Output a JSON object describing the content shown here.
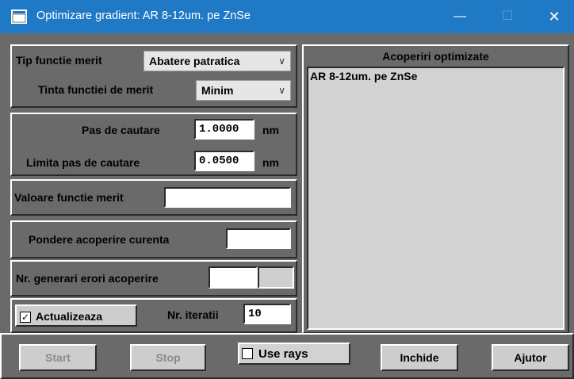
{
  "window": {
    "title": "Optimizare gradient: AR 8-12um. pe ZnSe",
    "minimize_glyph": "—",
    "maximize_glyph": "☐",
    "close_glyph": "✕"
  },
  "merit": {
    "type_label": "Tip functie merit",
    "type_value": "Abatere patratica",
    "target_label": "Tinta functiei de merit",
    "target_value": "Minim"
  },
  "search": {
    "step_label": "Pas de cautare",
    "step_value": "1.0000",
    "step_unit": "nm",
    "limit_label": "Limita pas de cautare",
    "limit_value": "0.0500",
    "limit_unit": "nm"
  },
  "merit_value": {
    "label": "Valoare functie merit",
    "value": ""
  },
  "weight": {
    "label": "Pondere acoperire curenta",
    "value": ""
  },
  "errors": {
    "label": "Nr. generari erori acoperire",
    "value": ""
  },
  "update": {
    "checkbox_label": "Actualizeaza",
    "checked": true,
    "check_glyph": "✓",
    "iter_label": "Nr. iteratii",
    "iter_value": "10"
  },
  "optimized": {
    "header": "Acoperiri optimizate",
    "items": [
      "AR 8-12um. pe ZnSe"
    ]
  },
  "buttons": {
    "start": "Start",
    "stop": "Stop",
    "use_rays": "Use rays",
    "close": "Inchide",
    "help": "Ajutor"
  },
  "colors": {
    "titlebar": "#1f79c4",
    "client_bg": "#6a6a6a",
    "list_bg": "#d2d2d2"
  }
}
